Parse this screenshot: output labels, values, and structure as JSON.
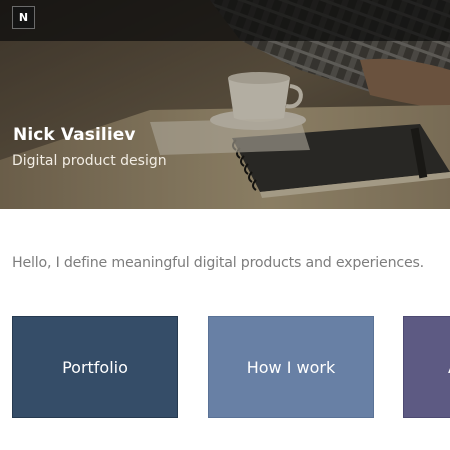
{
  "header": {
    "logo_text": "N"
  },
  "hero": {
    "name": "Nick Vasiliev",
    "tagline": "Digital product design"
  },
  "intro": {
    "text": "Hello, I define meaningful digital products and experiences."
  },
  "cards": [
    {
      "label": "Portfolio",
      "color": "#354d68"
    },
    {
      "label": "How I work",
      "color": "#6880a5"
    },
    {
      "label": "A",
      "color": "#5d5a83"
    }
  ]
}
